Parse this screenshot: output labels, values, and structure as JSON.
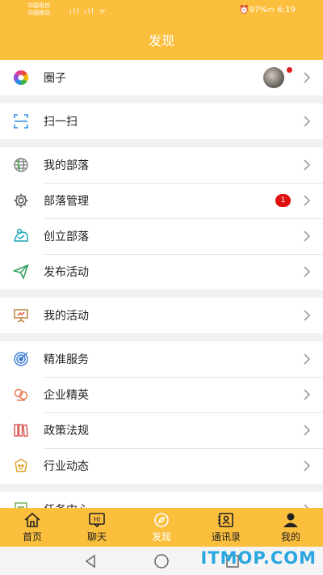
{
  "status_bar": {
    "carrier_1": "中国电信",
    "carrier_2": "中国移动",
    "indicators": "ıll ıll ᯤ",
    "battery": "⏰97%▭ 6:19"
  },
  "title": "发现",
  "groups": [
    {
      "items": [
        {
          "label": "圈子",
          "icon": "circle-colorful-icon"
        }
      ]
    },
    {
      "items": [
        {
          "label": "扫一扫",
          "icon": "scan-icon"
        }
      ]
    },
    {
      "items": [
        {
          "label": "我的部落",
          "icon": "globe-icon"
        },
        {
          "label": "部落管理",
          "icon": "gear-icon",
          "badge": "1"
        },
        {
          "label": "创立部落",
          "icon": "create-tribe-icon"
        },
        {
          "label": "发布活动",
          "icon": "paper-plane-icon"
        }
      ]
    },
    {
      "items": [
        {
          "label": "我的活动",
          "icon": "easel-icon"
        }
      ]
    },
    {
      "items": [
        {
          "label": "精准服务",
          "icon": "target-icon"
        },
        {
          "label": "企业精英",
          "icon": "elite-icon"
        },
        {
          "label": "政策法规",
          "icon": "books-icon"
        },
        {
          "label": "行业动态",
          "icon": "industry-icon"
        }
      ]
    },
    {
      "items": [
        {
          "label": "任务中心",
          "icon": "task-icon"
        }
      ]
    }
  ],
  "tabs": [
    {
      "label": "首页",
      "icon": "home-icon"
    },
    {
      "label": "聊天",
      "icon": "chat-icon"
    },
    {
      "label": "发现",
      "icon": "compass-icon",
      "active": true
    },
    {
      "label": "通讯录",
      "icon": "contacts-icon"
    },
    {
      "label": "我的",
      "icon": "user-icon"
    }
  ],
  "watermark": "ITMOP.COM",
  "colors": {
    "accent": "#fcbf3d",
    "badge": "#e01010"
  }
}
